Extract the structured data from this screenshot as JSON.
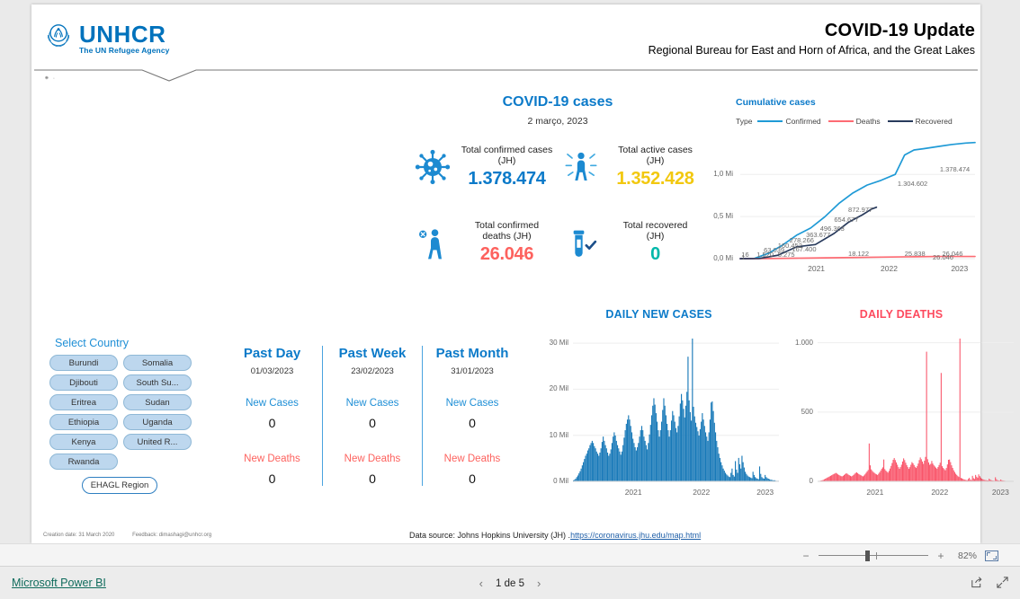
{
  "brand": {
    "logo_title": "UNHCR",
    "logo_subtitle": "The UN Refugee Agency",
    "logo_icon": "unhcr-laurel-icon",
    "accent_blue": "#0072bc"
  },
  "header": {
    "title": "COVID-19 Update",
    "subtitle": "Regional Bureau for East and Horn of Africa, and the Great Lakes"
  },
  "cases_panel": {
    "title": "COVID-19 cases",
    "date": "2 março, 2023",
    "kpis": [
      {
        "icon": "virus-icon",
        "label": "Total confirmed cases\n(JH)",
        "label_line1": "Total confirmed cases",
        "label_line2": "(JH)",
        "value": "1.378.474",
        "color": "#0b7ac9"
      },
      {
        "icon": "active-person-icon",
        "label_line1": "Total active cases",
        "label_line2": "(JH)",
        "value": "1.352.428",
        "color": "#f2c80f"
      },
      {
        "icon": "deceased-person-icon",
        "label_line1": "Total confirmed",
        "label_line2": "deaths (JH)",
        "value": "26.046",
        "color": "#fd625e"
      },
      {
        "icon": "test-tube-check-icon",
        "label_line1": "Total recovered",
        "label_line2": "(JH)",
        "value": "0",
        "color": "#01b8aa"
      }
    ]
  },
  "country_selector": {
    "title": "Select Country",
    "countries": [
      "Burundi",
      "Somalia",
      "Djibouti",
      "South Su...",
      "Eritrea",
      "Sudan",
      "Ethiopia",
      "Uganda",
      "Kenya",
      "United R...",
      "Rwanda"
    ],
    "region_button": "EHAGL Region"
  },
  "periods": [
    {
      "title": "Past Day",
      "date": "01/03/2023",
      "cases_label": "New Cases",
      "cases_value": "0",
      "deaths_label": "New Deaths",
      "deaths_value": "0"
    },
    {
      "title": "Past Week",
      "date": "23/02/2023",
      "cases_label": "New Cases",
      "cases_value": "0",
      "deaths_label": "New Deaths",
      "deaths_value": "0"
    },
    {
      "title": "Past Month",
      "date": "31/01/2023",
      "cases_label": "New Cases",
      "cases_value": "0",
      "deaths_label": "New Deaths",
      "deaths_value": "0"
    }
  ],
  "footer": {
    "creation_date": "Creation date: 31 March 2020",
    "feedback": "Feedback: dimashagi@unhcr.org",
    "data_source_prefix": "Data source: Johns Hopkins University (JH) .",
    "data_source_link": "https://coronavirus.jhu.edu/map.html"
  },
  "zoom_toolbar": {
    "minus": "−",
    "plus": "+",
    "percent": "82%",
    "fit_icon": "fit-to-page-icon"
  },
  "status_bar": {
    "brand_link": "Microsoft Power BI",
    "prev_icon": "chevron-left-icon",
    "next_icon": "chevron-right-icon",
    "page_label": "1 de 5",
    "share_icon": "share-icon",
    "fullscreen_icon": "fullscreen-icon"
  },
  "chart_data": [
    {
      "id": "cumulative",
      "type": "line",
      "title": "Cumulative cases",
      "legend_label": "Type",
      "legend_position": "top",
      "grid": true,
      "xlabel": "",
      "ylabel": "",
      "ytick_labels": [
        "1,0 Mi",
        "0,5 Mi",
        "0,0 Mi"
      ],
      "ytick_values": [
        1000000,
        500000,
        0
      ],
      "ylim": [
        0,
        1450000
      ],
      "xtick_labels": [
        "2021",
        "2022",
        "2023"
      ],
      "series": [
        {
          "name": "Confirmed",
          "color": "#1f9ad6",
          "x": [
            0,
            0.06,
            0.12,
            0.18,
            0.24,
            0.3,
            0.36,
            0.42,
            0.48,
            0.54,
            0.6,
            0.66,
            0.7,
            0.74,
            0.78,
            0.84,
            0.9,
            0.96,
            1.0
          ],
          "values": [
            16,
            1520,
            63039,
            160452,
            278266,
            363677,
            496363,
            654677,
            780000,
            872977,
            930000,
            1000000,
            1230000,
            1290000,
            1304602,
            1330000,
            1355000,
            1372000,
            1378474
          ]
        },
        {
          "name": "Deaths",
          "color": "#fd6b73",
          "x": [
            0,
            0.12,
            0.24,
            0.36,
            0.48,
            0.6,
            0.72,
            0.84,
            1.0
          ],
          "values": [
            1,
            1500,
            5275,
            9000,
            13000,
            18122,
            22000,
            25838,
            26046
          ]
        },
        {
          "name": "Recovered",
          "color": "#283a5c",
          "x": [
            0,
            0.08,
            0.16,
            0.24,
            0.32,
            0.4,
            0.46,
            0.52,
            0.56,
            0.58
          ],
          "values": [
            1,
            2000,
            40000,
            140000,
            167400,
            300000,
            430000,
            520000,
            590000,
            610000
          ]
        }
      ],
      "data_labels": [
        {
          "text": "16",
          "x": 0.005,
          "y": 0.0
        },
        {
          "text": "1",
          "x": 0.005,
          "y": -0.02
        },
        {
          "text": "1.520",
          "x": 0.07,
          "y": 0.0
        },
        {
          "text": "63.039",
          "x": 0.1,
          "y": 0.035
        },
        {
          "text": "5.275",
          "x": 0.16,
          "y": 0.0
        },
        {
          "text": "160.452",
          "x": 0.16,
          "y": 0.075
        },
        {
          "text": "167.400",
          "x": 0.22,
          "y": 0.045
        },
        {
          "text": "278.266",
          "x": 0.21,
          "y": 0.12
        },
        {
          "text": "363.677",
          "x": 0.28,
          "y": 0.16
        },
        {
          "text": "496.363",
          "x": 0.34,
          "y": 0.215
        },
        {
          "text": "654.677",
          "x": 0.4,
          "y": 0.285
        },
        {
          "text": "872.977",
          "x": 0.46,
          "y": 0.37
        },
        {
          "text": "18.122",
          "x": 0.46,
          "y": 0.01
        },
        {
          "text": "1.304.602",
          "x": 0.67,
          "y": 0.58
        },
        {
          "text": "25.838",
          "x": 0.7,
          "y": 0.01
        },
        {
          "text": "1.378.474",
          "x": 0.85,
          "y": 0.7
        },
        {
          "text": "26.046",
          "x": 0.86,
          "y": 0.01
        },
        {
          "text": "26.046",
          "x": 0.82,
          "y": -0.025
        }
      ]
    },
    {
      "id": "daily_new_cases",
      "type": "bar",
      "title": "DAILY NEW CASES",
      "color": "#1879b8",
      "grid": true,
      "ytick_labels": [
        "30 Mil",
        "20 Mil",
        "10 Mil",
        "0 Mil"
      ],
      "ytick_values": [
        30000000,
        20000000,
        10000000,
        0
      ],
      "ylim": [
        0,
        31000000
      ],
      "xtick_labels": [
        "2021",
        "2022",
        "2023"
      ],
      "values": [
        0.2,
        0.3,
        0.5,
        0.8,
        1.1,
        1.5,
        1.9,
        2.4,
        3.0,
        3.6,
        4.2,
        4.8,
        5.2,
        5.8,
        6.2,
        6.8,
        7.2,
        7.6,
        7.2,
        6.6,
        6.2,
        5.6,
        5.2,
        4.8,
        5.4,
        6.2,
        7.4,
        8.4,
        7.6,
        6.8,
        6.2,
        5.4,
        4.8,
        5.2,
        6.0,
        7.2,
        8.4,
        9.2,
        8.6,
        7.6,
        6.8,
        6.2,
        5.6,
        5.0,
        5.6,
        6.8,
        8.2,
        9.6,
        10.8,
        11.6,
        12.4,
        11.6,
        10.4,
        9.2,
        8.0,
        7.2,
        6.4,
        5.8,
        6.4,
        7.2,
        8.4,
        9.6,
        10.4,
        9.6,
        8.4,
        7.6,
        6.8,
        6.0,
        7.2,
        8.8,
        10.6,
        12.4,
        14.2,
        15.6,
        14.4,
        12.8,
        11.2,
        9.6,
        8.4,
        9.6,
        11.2,
        13.4,
        15.6,
        14.2,
        12.4,
        10.8,
        9.6,
        8.4,
        9.6,
        11.4,
        13.2,
        12.4,
        11.2,
        10.0,
        9.2,
        10.4,
        12.2,
        14.6,
        16.4,
        15.2,
        13.6,
        12.0,
        14.2,
        16.8,
        23.4,
        15.2,
        13.0,
        11.4,
        26.8,
        14.0,
        12.2,
        11.0,
        10.2,
        9.4,
        8.6,
        9.8,
        11.2,
        12.8,
        11.6,
        10.4,
        9.2,
        8.4,
        7.6,
        9.2,
        11.6,
        14.8,
        15.0,
        13.2,
        11.0,
        9.2,
        7.6,
        6.4,
        5.2,
        4.4,
        3.6,
        3.0,
        2.4,
        2.0,
        1.6,
        1.3,
        1.1,
        0.9,
        0.8,
        1.6,
        2.4,
        1.2,
        0.9,
        3.8,
        2.2,
        1.6,
        4.4,
        3.2,
        2.4,
        4.8,
        3.6,
        2.6,
        1.8,
        1.4,
        1.1,
        0.9,
        0.8,
        0.7,
        0.6,
        1.8,
        1.2,
        0.8,
        0.6,
        0.5,
        0.4,
        2.8,
        1.4,
        0.8,
        0.6,
        0.5,
        1.2,
        0.8,
        0.6,
        0.5,
        0.4,
        0.3,
        0.3,
        0.2,
        0.2,
        0.2,
        0.1,
        0.1,
        0.1
      ]
    },
    {
      "id": "daily_deaths",
      "type": "bar",
      "title": "DAILY DEATHS",
      "color": "#f9556a",
      "grid": true,
      "ytick_labels": [
        "1.000",
        "500",
        "0"
      ],
      "ytick_values": [
        1000,
        500,
        0
      ],
      "ylim": [
        0,
        1030
      ],
      "xtick_labels": [
        "2021",
        "2022",
        "2023"
      ],
      "values": [
        2,
        3,
        4,
        6,
        8,
        10,
        14,
        18,
        22,
        26,
        30,
        34,
        38,
        42,
        46,
        50,
        54,
        58,
        54,
        48,
        44,
        40,
        36,
        34,
        38,
        44,
        50,
        56,
        52,
        46,
        42,
        38,
        34,
        38,
        44,
        52,
        58,
        62,
        56,
        50,
        46,
        42,
        38,
        34,
        40,
        48,
        58,
        68,
        78,
        260,
        110,
        82,
        72,
        64,
        58,
        52,
        48,
        44,
        52,
        62,
        74,
        86,
        96,
        150,
        84,
        74,
        66,
        60,
        72,
        88,
        106,
        126,
        148,
        160,
        146,
        130,
        114,
        98,
        86,
        98,
        114,
        136,
        158,
        146,
        128,
        112,
        98,
        86,
        98,
        114,
        132,
        124,
        112,
        100,
        92,
        104,
        122,
        146,
        164,
        152,
        136,
        120,
        142,
        168,
        890,
        152,
        130,
        114,
        120,
        140,
        122,
        110,
        102,
        94,
        86,
        98,
        112,
        128,
        744,
        104,
        92,
        84,
        76,
        92,
        116,
        148,
        150,
        132,
        110,
        92,
        76,
        64,
        52,
        44,
        36,
        30,
        980,
        24,
        20,
        16,
        13,
        11,
        9,
        8,
        16,
        24,
        12,
        9,
        38,
        22,
        16,
        44,
        32,
        24,
        48,
        36,
        26,
        18,
        14,
        11,
        9,
        8,
        7,
        6,
        18,
        12,
        8,
        6,
        5,
        4,
        28,
        14,
        8,
        6,
        5,
        12,
        8,
        6,
        5,
        4,
        3,
        3,
        2,
        2,
        2,
        1,
        1,
        1
      ]
    }
  ]
}
